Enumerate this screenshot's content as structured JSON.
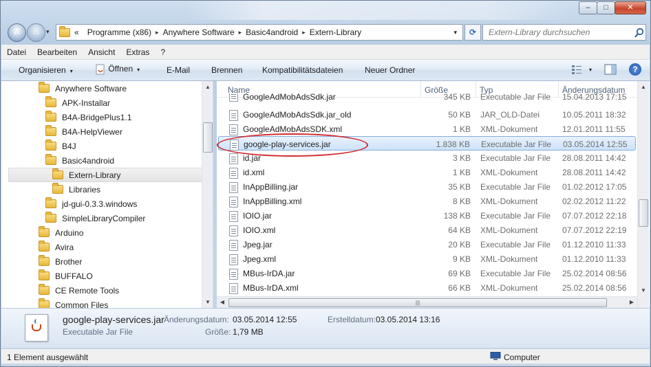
{
  "titlebar": {
    "minimize": "–",
    "maximize": "□",
    "close": "✕"
  },
  "nav": {
    "back_icon": "←",
    "forward_icon": "→",
    "dropdown_icon": "▾",
    "breadcrumb": [
      "«",
      "Programme (x86)",
      "Anywhere Software",
      "Basic4android",
      "Extern-Library"
    ],
    "crumb_sep": "▸",
    "refresh_icon": "⟳",
    "search_placeholder": "Extern-Library durchsuchen"
  },
  "menu": [
    "Datei",
    "Bearbeiten",
    "Ansicht",
    "Extras",
    "?"
  ],
  "toolbar": {
    "organize": "Organisieren",
    "open": "Öffnen",
    "email": "E-Mail",
    "burn": "Brennen",
    "compat": "Kompatibilitätsdateien",
    "new_folder": "Neuer Ordner",
    "arrow": "▾",
    "help": "?"
  },
  "tree": [
    {
      "label": "Anywhere Software"
    },
    {
      "label": "APK-Installar"
    },
    {
      "label": "B4A-BridgePlus1.1"
    },
    {
      "label": "B4A-HelpViewer"
    },
    {
      "label": "B4J"
    },
    {
      "label": "Basic4android"
    },
    {
      "label": "Extern-Library"
    },
    {
      "label": "Libraries"
    },
    {
      "label": "jd-gui-0.3.3.windows"
    },
    {
      "label": "SimpleLibraryCompiler"
    },
    {
      "label": "Arduino"
    },
    {
      "label": "Avira"
    },
    {
      "label": "Brother"
    },
    {
      "label": "BUFFALO"
    },
    {
      "label": "CE Remote Tools"
    },
    {
      "label": "Common Files"
    }
  ],
  "columns": {
    "name": "Name",
    "size": "Größe",
    "type": "Typ",
    "date": "Änderungsdatum"
  },
  "files": [
    {
      "name": "GoogleAdMobAdsSdk.jar",
      "size": "345 KB",
      "type": "Executable Jar File",
      "date": "15.04.2013 17:15"
    },
    {
      "name": "GoogleAdMobAdsSdk.jar_old",
      "size": "50 KB",
      "type": "JAR_OLD-Datei",
      "date": "10.05.2011 18:32"
    },
    {
      "name": "GoogleAdMobAdsSDK.xml",
      "size": "1 KB",
      "type": "XML-Dokument",
      "date": "12.01.2011 11:55"
    },
    {
      "name": "google-play-services.jar",
      "size": "1.838 KB",
      "type": "Executable Jar File",
      "date": "03.05.2014 12:55"
    },
    {
      "name": "id.jar",
      "size": "3 KB",
      "type": "Executable Jar File",
      "date": "28.08.2011 14:42"
    },
    {
      "name": "id.xml",
      "size": "1 KB",
      "type": "XML-Dokument",
      "date": "28.08.2011 14:42"
    },
    {
      "name": "InAppBilling.jar",
      "size": "35 KB",
      "type": "Executable Jar File",
      "date": "01.02.2012 17:05"
    },
    {
      "name": "InAppBilling.xml",
      "size": "8 KB",
      "type": "XML-Dokument",
      "date": "02.02.2012 11:22"
    },
    {
      "name": "IOIO.jar",
      "size": "138 KB",
      "type": "Executable Jar File",
      "date": "07.07.2012 22:18"
    },
    {
      "name": "IOIO.xml",
      "size": "64 KB",
      "type": "XML-Dokument",
      "date": "07.07.2012 22:19"
    },
    {
      "name": "Jpeg.jar",
      "size": "20 KB",
      "type": "Executable Jar File",
      "date": "01.12.2010 11:33"
    },
    {
      "name": "Jpeg.xml",
      "size": "9 KB",
      "type": "XML-Dokument",
      "date": "01.12.2010 11:33"
    },
    {
      "name": "MBus-IrDA.jar",
      "size": "69 KB",
      "type": "Executable Jar File",
      "date": "25.02.2014 08:56"
    },
    {
      "name": "MBus-IrDA.xml",
      "size": "66 KB",
      "type": "XML-Dokument",
      "date": "25.02.2014 08:56"
    }
  ],
  "details": {
    "name": "google-play-services.jar",
    "type": "Executable Jar File",
    "modified_label": "Änderungsdatum:",
    "modified": "03.05.2014 12:55",
    "created_label": "Erstelldatum:",
    "created": "03.05.2014 13:16",
    "size_label": "Größe:",
    "size": "1,79 MB"
  },
  "status": {
    "selection": "1 Element ausgewählt",
    "location": "Computer"
  }
}
